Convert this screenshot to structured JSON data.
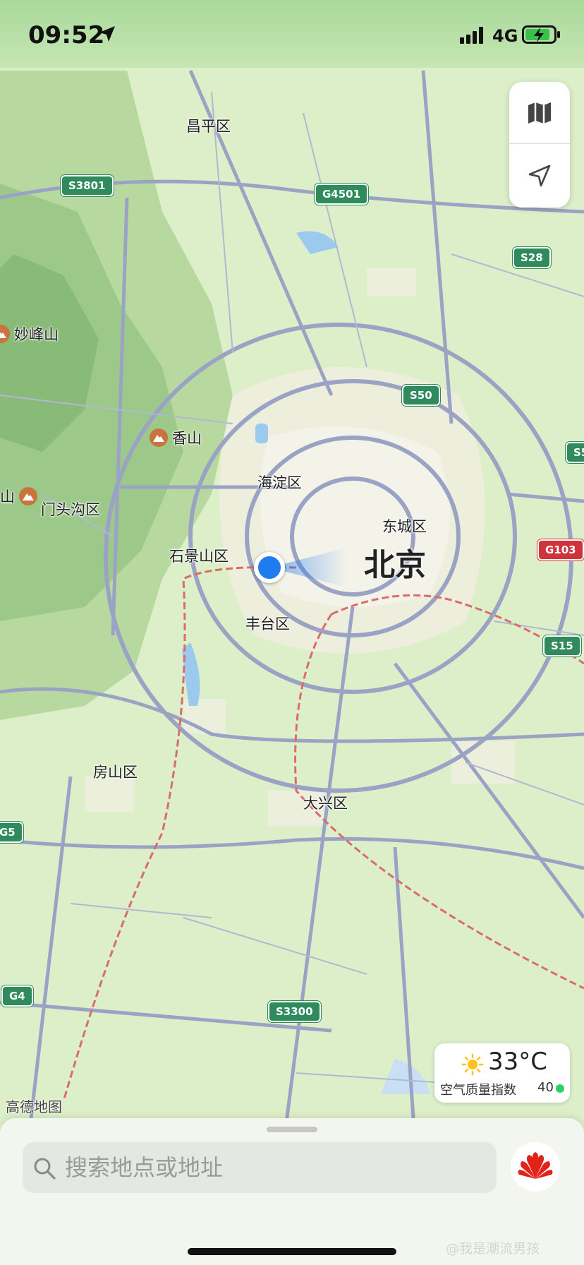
{
  "status_bar": {
    "time": "09:52",
    "network": "4G"
  },
  "map_controls": {
    "layers_icon": "map-icon",
    "locate_icon": "navigation-arrow-icon"
  },
  "map": {
    "districts": {
      "changping": "昌平区",
      "haidian": "海淀区",
      "dongcheng": "东城区",
      "shijingshan": "石景山区",
      "mentougou": "门头沟区",
      "fengtai": "丰台区",
      "fangshan": "房山区",
      "daxing": "大兴区"
    },
    "city": "北京",
    "pois": {
      "miaofengshan": "妙峰山",
      "xiangshan": "香山",
      "edge_mountain": "山"
    },
    "highways": {
      "s3801": "S3801",
      "g4501": "G4501",
      "s28": "S28",
      "s50": "S50",
      "s5": "S5",
      "g103": "G103",
      "s15": "S15",
      "g5": "G5",
      "g4": "G4",
      "s3300": "S3300"
    },
    "watermark": "高德地图"
  },
  "weather": {
    "temperature": "33°C",
    "air_quality_label": "空气质量指数",
    "air_quality_value": "40",
    "status_color": "#2ecf6b"
  },
  "search": {
    "placeholder": "搜索地点或地址"
  },
  "footer": {
    "corner_mark": "@我是潮流男孩"
  }
}
